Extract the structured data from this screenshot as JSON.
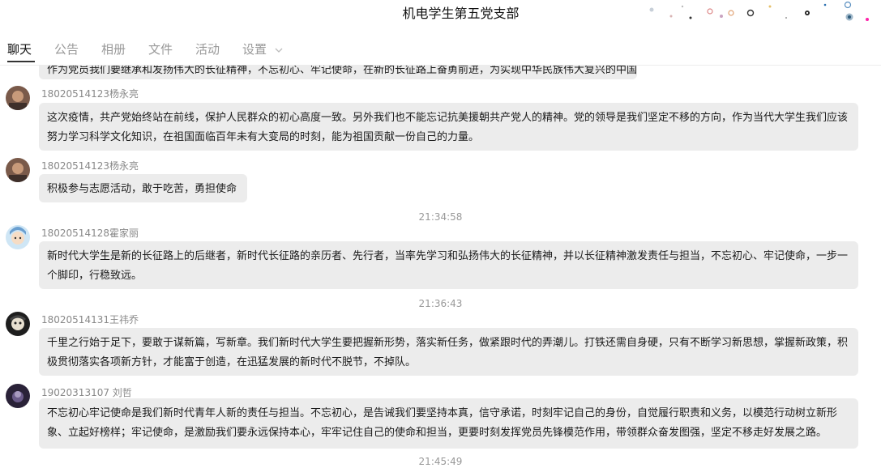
{
  "window": {
    "title": "机电学生第五党支部"
  },
  "tabs": [
    {
      "label": "聊天",
      "active": true
    },
    {
      "label": "公告",
      "active": false
    },
    {
      "label": "相册",
      "active": false
    },
    {
      "label": "文件",
      "active": false
    },
    {
      "label": "活动",
      "active": false
    },
    {
      "label": "设置",
      "active": false
    }
  ],
  "messages": [
    {
      "sender": "18020514123杨永亮",
      "text": "这次疫情，共产党始终站在前线，保护人民群众的初心高度一致。另外我们也不能忘记抗美援朝共产党人的精神。党的领导是我们坚定不移的方向，作为当代大学生我们应该努力学习科学文化知识，在祖国面临百年未有大变局的时刻，能为祖国贡献一份自己的力量。",
      "line1": "这次疫情，共产党始终站在前线，保护人民群众的初心高度一致。另外我们也不能忘记抗美援朝共产党人的精神。党的领导是我们坚定不移的方向，作为当代大学生我们应该",
      "line2": "努力学习科学文化知识，在祖国面临百年未有大变局的时刻，能为祖国贡献一份自己的力量。"
    },
    {
      "sender": "18020514123杨永亮",
      "text": "积极参与志愿活动，敢于吃苦，勇担使命"
    },
    {
      "time": "21:34:58"
    },
    {
      "sender": "18020514128霍家丽",
      "line1": "新时代大学生是新的长征路上的后继者，新时代长征路的亲历者、先行者，当率先学习和弘扬伟大的长征精神，并以长征精神激发责任与担当，不忘初心、牢记使命，一步一",
      "line2": "个脚印，行稳致远。"
    },
    {
      "time": "21:36:43"
    },
    {
      "sender": "18020514131王祎乔",
      "line1": "千里之行始于足下，要敢于谋新篇，写新章。我们新时代大学生要把握新形势，落实新任务，做紧跟时代的弄潮儿。打铁还需自身硬，只有不断学习新思想，掌握新政策，积",
      "line2": "极贯彻落实各项新方针，才能富于创造，在迅猛发展的新时代不脱节，不掉队。"
    },
    {
      "sender": "19020313107  刘哲",
      "line1": "不忘初心牢记使命是我们新时代青年人新的责任与担当。不忘初心，是告诫我们要坚持本真，信守承诺，时刻牢记自己的身份，自觉履行职责和义务，以模范行动树立新形",
      "line2": "象、立起好榜样；牢记使命，是激励我们要永远保持本心，牢牢记住自己的使命和担当，更要时刻发挥党员先锋模范作用，带领群众奋发图强，坚定不移走好发展之路。"
    },
    {
      "time": "21:45:49"
    }
  ],
  "partial_previous_message": "作为党员我们要继承和发扬伟大的长征精神，不忘初心、牢记使命，在新的长征路上奋勇前进，为实现中华民族伟大复兴的中国梦而努力奋斗。"
}
